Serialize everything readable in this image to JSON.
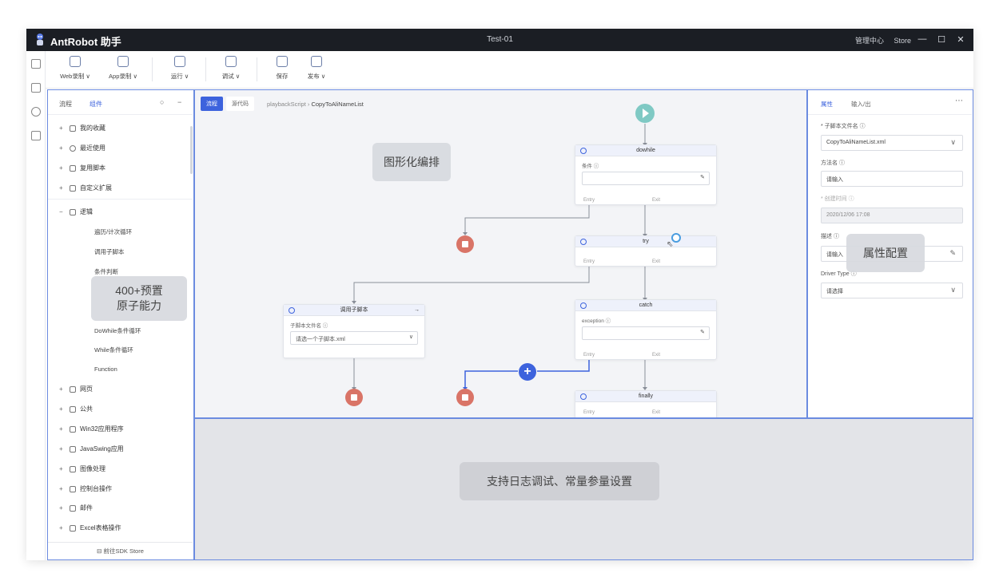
{
  "window": {
    "app_name": "AntRobot 助手",
    "title": "Test-01",
    "menu_right": [
      "管理中心",
      "Store"
    ]
  },
  "toolbar": [
    {
      "label": "Web录制 ∨"
    },
    {
      "label": "App录制 ∨"
    },
    {
      "label": "运行 ∨"
    },
    {
      "label": "调试 ∨"
    },
    {
      "label": "保存"
    },
    {
      "label": "发布 ∨"
    }
  ],
  "sidebar": {
    "tabs": [
      "流程",
      "组件"
    ],
    "groups_top": [
      {
        "pm": "+",
        "label": "我的收藏"
      },
      {
        "pm": "+",
        "label": "最近使用"
      },
      {
        "pm": "+",
        "label": "复用脚本"
      },
      {
        "pm": "+",
        "label": "自定义扩展"
      }
    ],
    "logic_group": {
      "pm": "−",
      "label": "逻辑"
    },
    "logic_items": [
      "遍历/计次循环",
      "调用子脚本",
      "条件判断",
      "DoWhile条件循环",
      "While条件循环",
      "Function"
    ],
    "groups_bottom": [
      {
        "pm": "+",
        "label": "网页"
      },
      {
        "pm": "+",
        "label": "公共"
      },
      {
        "pm": "+",
        "label": "Win32应用程序"
      },
      {
        "pm": "+",
        "label": "JavaSwing应用"
      },
      {
        "pm": "+",
        "label": "图像处理"
      },
      {
        "pm": "+",
        "label": "控制台操作"
      },
      {
        "pm": "+",
        "label": "邮件"
      },
      {
        "pm": "+",
        "label": "Excel表格操作"
      }
    ],
    "footer": "前往SDK Store",
    "overlay_text": [
      "400+预置",
      "原子能力"
    ]
  },
  "canvas": {
    "tabs": [
      "流程",
      "源代码"
    ],
    "breadcrumb": {
      "parent": "playbackScript",
      "current": "CopyToAliNameList"
    },
    "overlay_text": "图形化编排",
    "nodes": {
      "dowhile": {
        "title": "dowhile",
        "field_label": "条件 ⓘ",
        "foot_left": "Entry",
        "foot_right": "Exit"
      },
      "try": {
        "title": "try",
        "foot_left": "Entry",
        "foot_right": "Exit"
      },
      "catch": {
        "title": "catch",
        "field_label": "exception ⓘ",
        "foot_left": "Entry",
        "foot_right": "Exit"
      },
      "finally": {
        "title": "finally",
        "foot_left": "Entry",
        "foot_right": "Exit"
      },
      "subscript": {
        "title": "调用子脚本",
        "field_label": "子脚本文件名 ⓘ",
        "value": "请选一个子脚本.xml"
      }
    }
  },
  "props": {
    "tabs": [
      "属性",
      "输入/出"
    ],
    "fields": [
      {
        "label": "* 子脚本文件名 ⓘ",
        "value": "CopyToAliNameList.xml"
      },
      {
        "label": "方法名 ⓘ",
        "value": "请输入"
      },
      {
        "label": "* 创建时间 ⓘ",
        "value": "2020/12/06 17:08"
      },
      {
        "label": "描述 ⓘ",
        "value": "请输入"
      },
      {
        "label": "Driver Type ⓘ",
        "value": "请选择"
      }
    ],
    "overlay_text": "属性配置"
  },
  "bottom": {
    "overlay_text": "支持日志调试、常量参量设置"
  },
  "colors": {
    "accent": "#3d63dd",
    "titlebar": "#1b1e24",
    "stop": "#d97467",
    "start": "#7fc9c4"
  }
}
